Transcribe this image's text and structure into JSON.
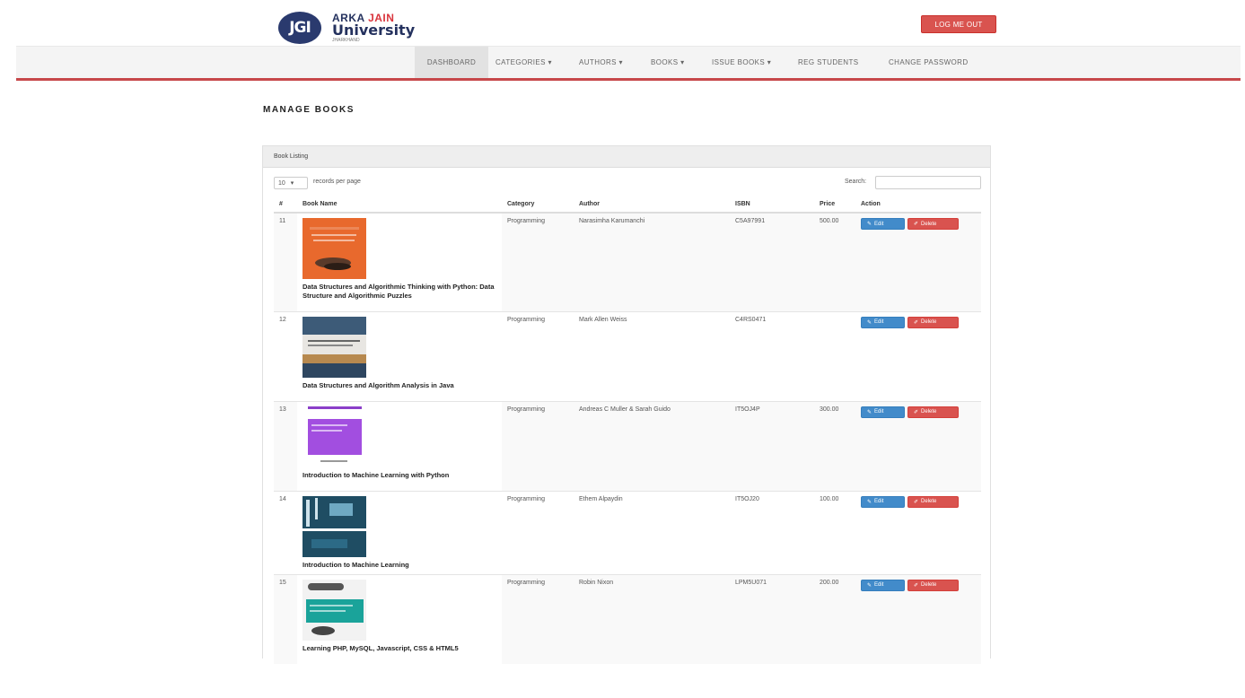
{
  "brand": {
    "badge": "JGI",
    "line1_a": "ARKA",
    "line1_b": "JAIN",
    "line2": "University",
    "line3": "JHARKHAND"
  },
  "header": {
    "logout_label": "LOG ME OUT"
  },
  "nav": {
    "items": [
      {
        "label": "DASHBOARD",
        "active": true
      },
      {
        "label": "CATEGORIES ▾"
      },
      {
        "label": "AUTHORS ▾"
      },
      {
        "label": "BOOKS ▾"
      },
      {
        "label": "ISSUE BOOKS ▾"
      },
      {
        "label": "REG STUDENTS"
      },
      {
        "label": "CHANGE PASSWORD"
      }
    ]
  },
  "page": {
    "title": "MANAGE BOOKS"
  },
  "panel": {
    "heading": "Book Listing",
    "length_value": "10",
    "length_label": "records per page",
    "search_label": "Search:",
    "search_value": ""
  },
  "table": {
    "columns": [
      "#",
      "Book Name",
      "Category",
      "Author",
      "ISBN",
      "Price",
      "Action"
    ],
    "edit_label": "Edit",
    "delete_label": "Delete",
    "rows": [
      {
        "num": "11",
        "title": "Data Structures and Algorithmic Thinking with Python: Data Structure and Algorithmic Puzzles",
        "category": "Programming",
        "author": "Narasimha Karumanchi",
        "isbn": "C5A97991",
        "price": "500.00"
      },
      {
        "num": "12",
        "title": "Data Structures and Algorithm Analysis in Java",
        "category": "Programming",
        "author": "Mark Allen Weiss",
        "isbn": "C4RS0471",
        "price": ""
      },
      {
        "num": "13",
        "title": "Introduction to Machine Learning with Python",
        "category": "Programming",
        "author": "Andreas C Muller & Sarah Guido",
        "isbn": "IT5OJ4P",
        "price": "300.00"
      },
      {
        "num": "14",
        "title": "Introduction to Machine Learning",
        "category": "Programming",
        "author": "Ethem Alpaydin",
        "isbn": "IT5OJ20",
        "price": "100.00"
      },
      {
        "num": "15",
        "title": "Learning PHP, MySQL, Javascript, CSS & HTML5",
        "category": "Programming",
        "author": "Robin Nixon",
        "isbn": "LPM5U071",
        "price": "200.00"
      }
    ]
  }
}
